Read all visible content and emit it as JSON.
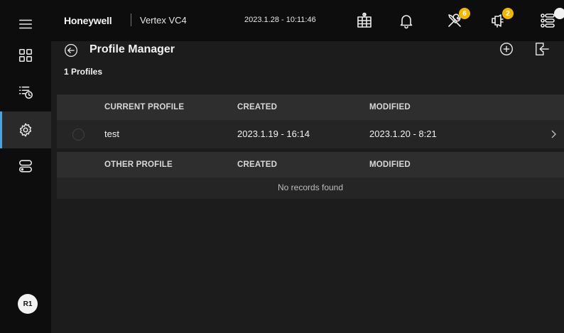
{
  "header": {
    "brand": "Honeywell",
    "product": "Vertex VC4",
    "datetime": "2023.1.28 - 10:11:46",
    "badges": {
      "tools": "6",
      "maintenance": "2"
    }
  },
  "page": {
    "title": "Profile Manager",
    "count_label": "1 Profiles"
  },
  "current_table": {
    "columns": [
      "CURRENT PROFILE",
      "CREATED",
      "MODIFIED"
    ],
    "rows": [
      {
        "name": "test",
        "created": "2023.1.19 - 16:14",
        "modified": "2023.1.20 - 8:21"
      }
    ]
  },
  "other_table": {
    "columns": [
      "OTHER PROFILE",
      "CREATED",
      "MODIFIED"
    ],
    "empty_message": "No records found"
  },
  "user": {
    "initials": "R1"
  },
  "colors": {
    "badge": "#f2b705",
    "active_indicator": "#4aa3df",
    "background": "#1c1c1c"
  },
  "icons": {
    "sidebar": [
      "menu-icon",
      "dashboard-grid-icon",
      "schedule-list-icon",
      "settings-gear-icon",
      "device-icon"
    ],
    "top": [
      "calendar-icon",
      "bell-icon",
      "tools-icon",
      "maintenance-icon",
      "list-icon"
    ]
  }
}
